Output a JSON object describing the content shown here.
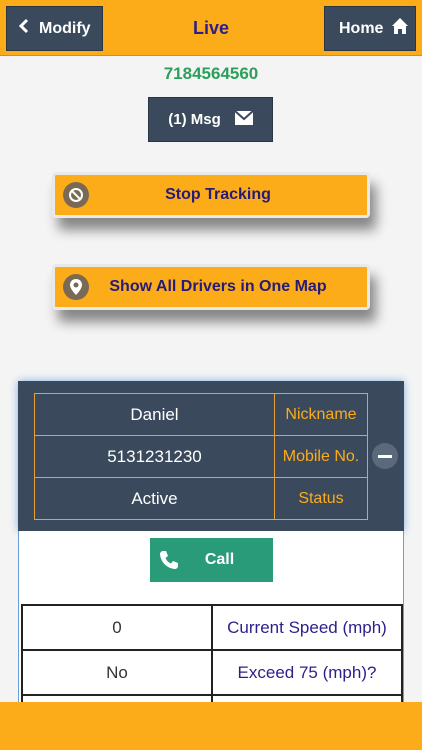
{
  "header": {
    "back_label": "Modify",
    "title": "Live",
    "home_label": "Home"
  },
  "phone_number": "7184564560",
  "message_button": "(1) Msg",
  "actions": {
    "stop_tracking": "Stop Tracking",
    "show_all": "Show All Drivers in One Map"
  },
  "driver": {
    "rows": [
      {
        "value": "Daniel",
        "label": "Nickname"
      },
      {
        "value": "5131231230",
        "label": "Mobile No."
      },
      {
        "value": "Active",
        "label": "Status"
      }
    ]
  },
  "call_label": "Call",
  "stats": [
    {
      "value": "0",
      "label": "Current Speed (mph)"
    },
    {
      "value": "No",
      "label": "Exceed 75 (mph)?"
    }
  ],
  "colors": {
    "accent": "#fcac19",
    "dark": "#3a4a5c",
    "title": "#2b1f8a",
    "phone": "#2ca05a",
    "call": "#2a9b78"
  }
}
